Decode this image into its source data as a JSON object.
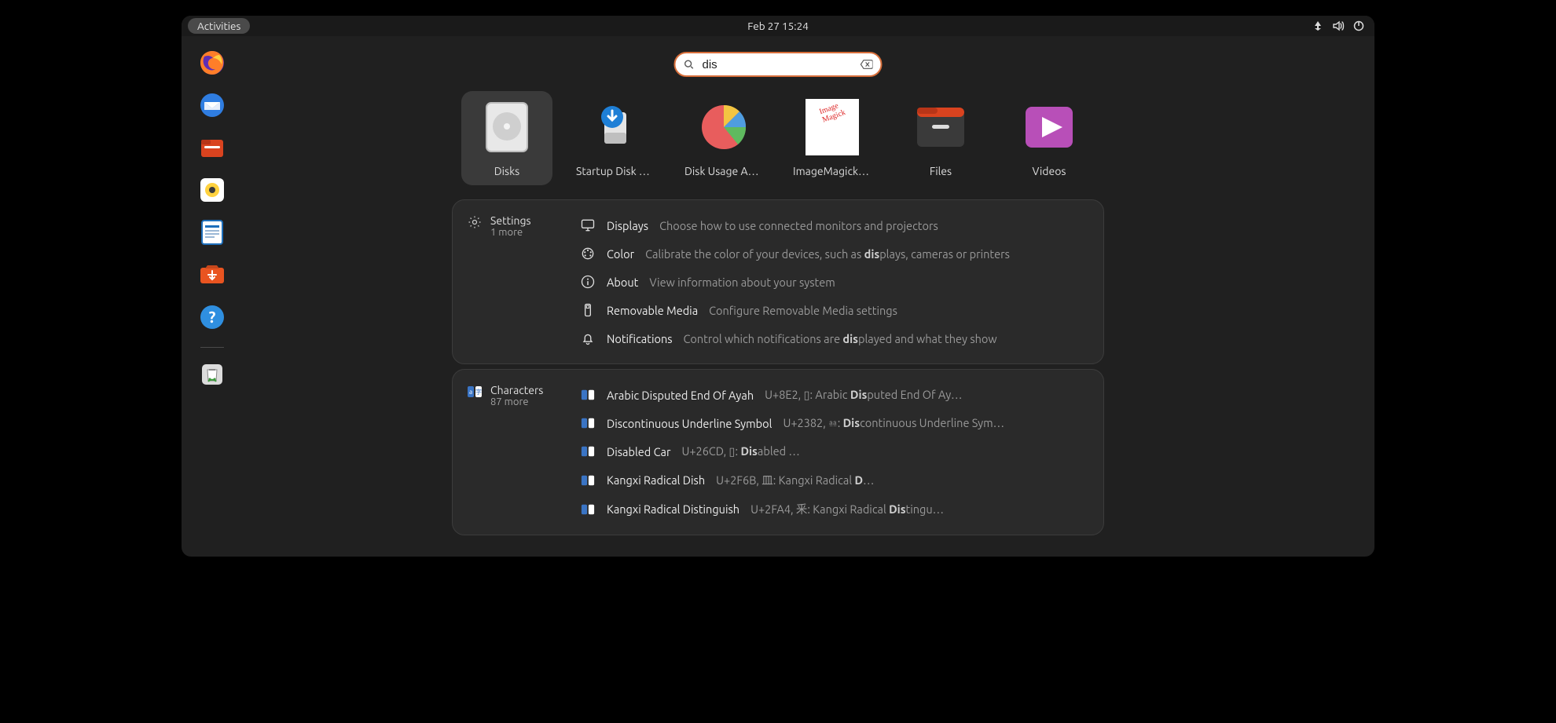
{
  "topbar": {
    "activities": "Activities",
    "clock": "Feb 27  15:24"
  },
  "dock": {
    "items": [
      {
        "name": "firefox-icon",
        "color": "#ff7e29",
        "inner": "#5e2db5"
      },
      {
        "name": "thunderbird-icon",
        "color": "#2f7de1",
        "inner": "#ffffff"
      },
      {
        "name": "files-icon",
        "color": "#d9431f",
        "inner": "#ffffff"
      },
      {
        "name": "rhythmbox-icon",
        "color": "#ffffff",
        "inner": "#3a3a3a"
      },
      {
        "name": "writer-icon",
        "color": "#ffffff",
        "inner": "#1e6fbb"
      },
      {
        "name": "software-icon",
        "color": "#e95420",
        "inner": "#ffffff"
      },
      {
        "name": "help-icon",
        "color": "#2f8fe0",
        "inner": "#ffffff"
      },
      {
        "name": "trash-icon",
        "color": "#dcdcdc",
        "inner": "#3d9a3d"
      }
    ]
  },
  "search": {
    "query": "dis"
  },
  "apps": [
    {
      "label": "Disks",
      "selected": true,
      "icon": "disks"
    },
    {
      "label": "Startup Disk Cr…",
      "selected": false,
      "icon": "startupdisk"
    },
    {
      "label": "Disk Usage Ana…",
      "selected": false,
      "icon": "baobab"
    },
    {
      "label": "ImageMagick (c…",
      "selected": false,
      "icon": "imagemagick"
    },
    {
      "label": "Files",
      "selected": false,
      "icon": "filesapp"
    },
    {
      "label": "Videos",
      "selected": false,
      "icon": "videos"
    }
  ],
  "providers": {
    "settings": {
      "title": "Settings",
      "more": "1 more",
      "rows": [
        {
          "icon": "displays",
          "title": "Displays",
          "desc_pre": "Choose how to use connected monitors and projectors",
          "hl": "",
          "desc_post": ""
        },
        {
          "icon": "color",
          "title": "Color",
          "desc_pre": "Calibrate the color of your devices, such as ",
          "hl": "dis",
          "desc_post": "plays, cameras or printers"
        },
        {
          "icon": "about",
          "title": "About",
          "desc_pre": "View information about your system",
          "hl": "",
          "desc_post": ""
        },
        {
          "icon": "removable",
          "title": "Removable Media",
          "desc_pre": "Configure Removable Media settings",
          "hl": "",
          "desc_post": ""
        },
        {
          "icon": "bell",
          "title": "Notifications",
          "desc_pre": "Control which notifications are ",
          "hl": "dis",
          "desc_post": "played and what they show"
        }
      ]
    },
    "characters": {
      "title": "Characters",
      "more": "87 more",
      "rows": [
        {
          "title": "Arabic Disputed End Of Ayah",
          "desc_pre": "U+8E2, ▯: Arabic ",
          "hl": "Dis",
          "desc_post": "puted End Of Ay…"
        },
        {
          "title": "Discontinuous Underline Symbol",
          "desc_pre": "U+2382, ⎂: ",
          "hl": "Dis",
          "desc_post": "continuous Underline Sym…"
        },
        {
          "title": "Disabled Car",
          "desc_pre": "U+26CD, ▯: ",
          "hl": "Dis",
          "desc_post": "abled …"
        },
        {
          "title": "Kangxi Radical Dish",
          "desc_pre": "U+2F6B, ⽫: Kangxi Radical ",
          "hl": "D",
          "desc_post": "…"
        },
        {
          "title": "Kangxi Radical Distinguish",
          "desc_pre": "U+2FA4, 釆: Kangxi Radical ",
          "hl": "Dis",
          "desc_post": "tingu…"
        }
      ]
    }
  }
}
